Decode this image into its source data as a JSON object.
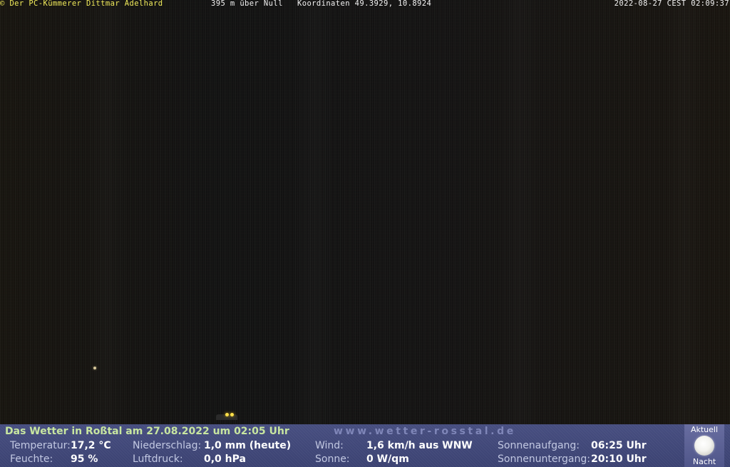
{
  "overlay": {
    "credit": "© Der PC-Kümmerer Dittmar Adelhard",
    "elevation": "395 m über Null",
    "coords": "Koordinaten 49.3929, 10.8924",
    "timestamp": "2022-08-27 CEST 02:09:37"
  },
  "weather": {
    "title": "Das Wetter in Roßtal am 27.08.2022 um 02:05 Uhr",
    "url": "www.wetter-rosstal.de",
    "temperature_label": "Temperatur:",
    "temperature_value": "17,2 °C",
    "humidity_label": "Feuchte:",
    "humidity_value": "95 %",
    "precip_label": "Niederschlag:",
    "precip_value": "1,0 mm (heute)",
    "pressure_label": "Luftdruck:",
    "pressure_value": "0,0 hPa",
    "wind_label": "Wind:",
    "wind_value": "1,6 km/h aus WNW",
    "sun_label": "Sonne:",
    "sun_value": "0 W/qm",
    "sunrise_label": "Sonnenaufgang:",
    "sunrise_value": "06:25 Uhr",
    "sunset_label": "Sonnenuntergang:",
    "sunset_value": "20:10 Uhr",
    "moon_top": "Aktuell",
    "moon_bottom": "Nacht",
    "moon_icon": "full-moon-icon"
  },
  "colors": {
    "overlay_credit": "#f2ec5b",
    "overlay_text": "#f2f2f2",
    "panel_bg": "#3f4676",
    "title": "#c8e6a0",
    "value": "#ffffff"
  }
}
